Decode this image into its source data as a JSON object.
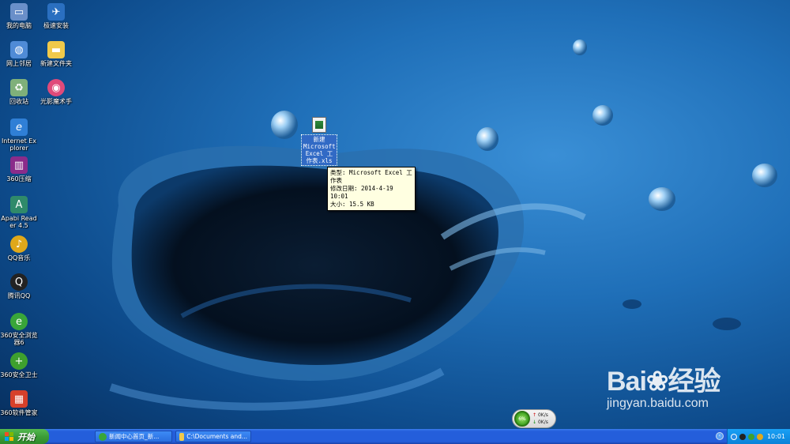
{
  "desktop": {
    "icons": [
      {
        "label": "我的电脑",
        "icon": "my-computer-icon",
        "color": "#6a8fc9"
      },
      {
        "label": "网上邻居",
        "icon": "network-places-icon",
        "color": "#4f8bd6"
      },
      {
        "label": "回收站",
        "icon": "recycle-bin-icon",
        "color": "#7fb07a"
      },
      {
        "label": "Internet Explorer",
        "icon": "internet-explorer-icon",
        "color": "#2f7fd6"
      },
      {
        "label": "360压缩",
        "icon": "360-compress-icon",
        "color": "#8a2c8a"
      },
      {
        "label": "Apabi Reader 4.5",
        "icon": "apabi-reader-icon",
        "color": "#2f8a6a"
      },
      {
        "label": "QQ音乐",
        "icon": "qq-music-icon",
        "color": "#e0a81a"
      },
      {
        "label": "腾讯QQ",
        "icon": "tencent-qq-icon",
        "color": "#222222"
      },
      {
        "label": "360安全浏览器6",
        "icon": "360-browser-icon",
        "color": "#39a639"
      },
      {
        "label": "360安全卫士",
        "icon": "360-safe-icon",
        "color": "#3ea02e"
      },
      {
        "label": "360软件管家",
        "icon": "360-software-manager-icon",
        "color": "#d6402a"
      },
      {
        "label": "极速安装",
        "icon": "fast-install-icon",
        "color": "#2a6fc0"
      },
      {
        "label": "新建文件夹",
        "icon": "folder-icon",
        "color": "#f0c94a"
      },
      {
        "label": "光影魔术手",
        "icon": "photo-magic-icon",
        "color": "#e04a7a"
      }
    ],
    "selected_file": {
      "label": "新建 Microsoft Excel 工作表.xls",
      "icon": "excel-file-icon"
    },
    "tooltip": {
      "type_line": "类型: Microsoft Excel 工作表",
      "date_line": "修改日期: 2014-4-19 10:01",
      "size_line": "大小: 15.5 KB"
    }
  },
  "net_widget": {
    "percent": "6%",
    "up": "0K/s",
    "down": "0K/s"
  },
  "watermark": {
    "brand_left": "Bai",
    "brand_right": "经验",
    "url": "jingyan.baidu.com"
  },
  "taskbar": {
    "start_label": "开始",
    "tasks": [
      {
        "label": "新闻中心首页_新...",
        "icon": "browser-task-icon"
      },
      {
        "label": "C:\\Documents and...",
        "icon": "folder-task-icon"
      }
    ],
    "clock": "10:01"
  },
  "colors": {
    "taskbar": "#245edb",
    "start": "#3c9d37",
    "tray": "#0b82d8",
    "selection": "#316ac5",
    "tooltip": "#ffffe1"
  }
}
